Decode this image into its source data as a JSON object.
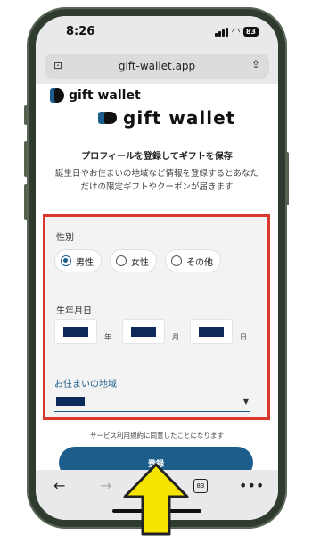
{
  "status": {
    "time": "8:26",
    "battery": "83"
  },
  "browser": {
    "url": "gift-wallet.app",
    "tabs_count": "83"
  },
  "brand": {
    "name": "gift wallet"
  },
  "intro": {
    "title": "プロフィールを登録してギフトを保存",
    "description": "誕生日やお住まいの地域など情報を登録するとあなただけの限定ギフトやクーポンが届きます"
  },
  "form": {
    "gender_label": "性別",
    "gender_options": [
      "男性",
      "女性",
      "その他"
    ],
    "gender_selected": "男性",
    "dob_label": "生年月日",
    "dob_units": {
      "year": "年",
      "month": "月",
      "day": "日"
    },
    "region_label": "お住まいの地域"
  },
  "notice": "サービス利用規約に同意したことになります",
  "register_label": "登録",
  "colors": {
    "accent": "#1b5e8b",
    "highlight_border": "#d9392c",
    "arrow": "#f5e400"
  },
  "icons": [
    "back-icon",
    "forward-icon",
    "tabs-icon",
    "more-icon",
    "share-icon",
    "reader-icon",
    "chevron-down-icon"
  ]
}
